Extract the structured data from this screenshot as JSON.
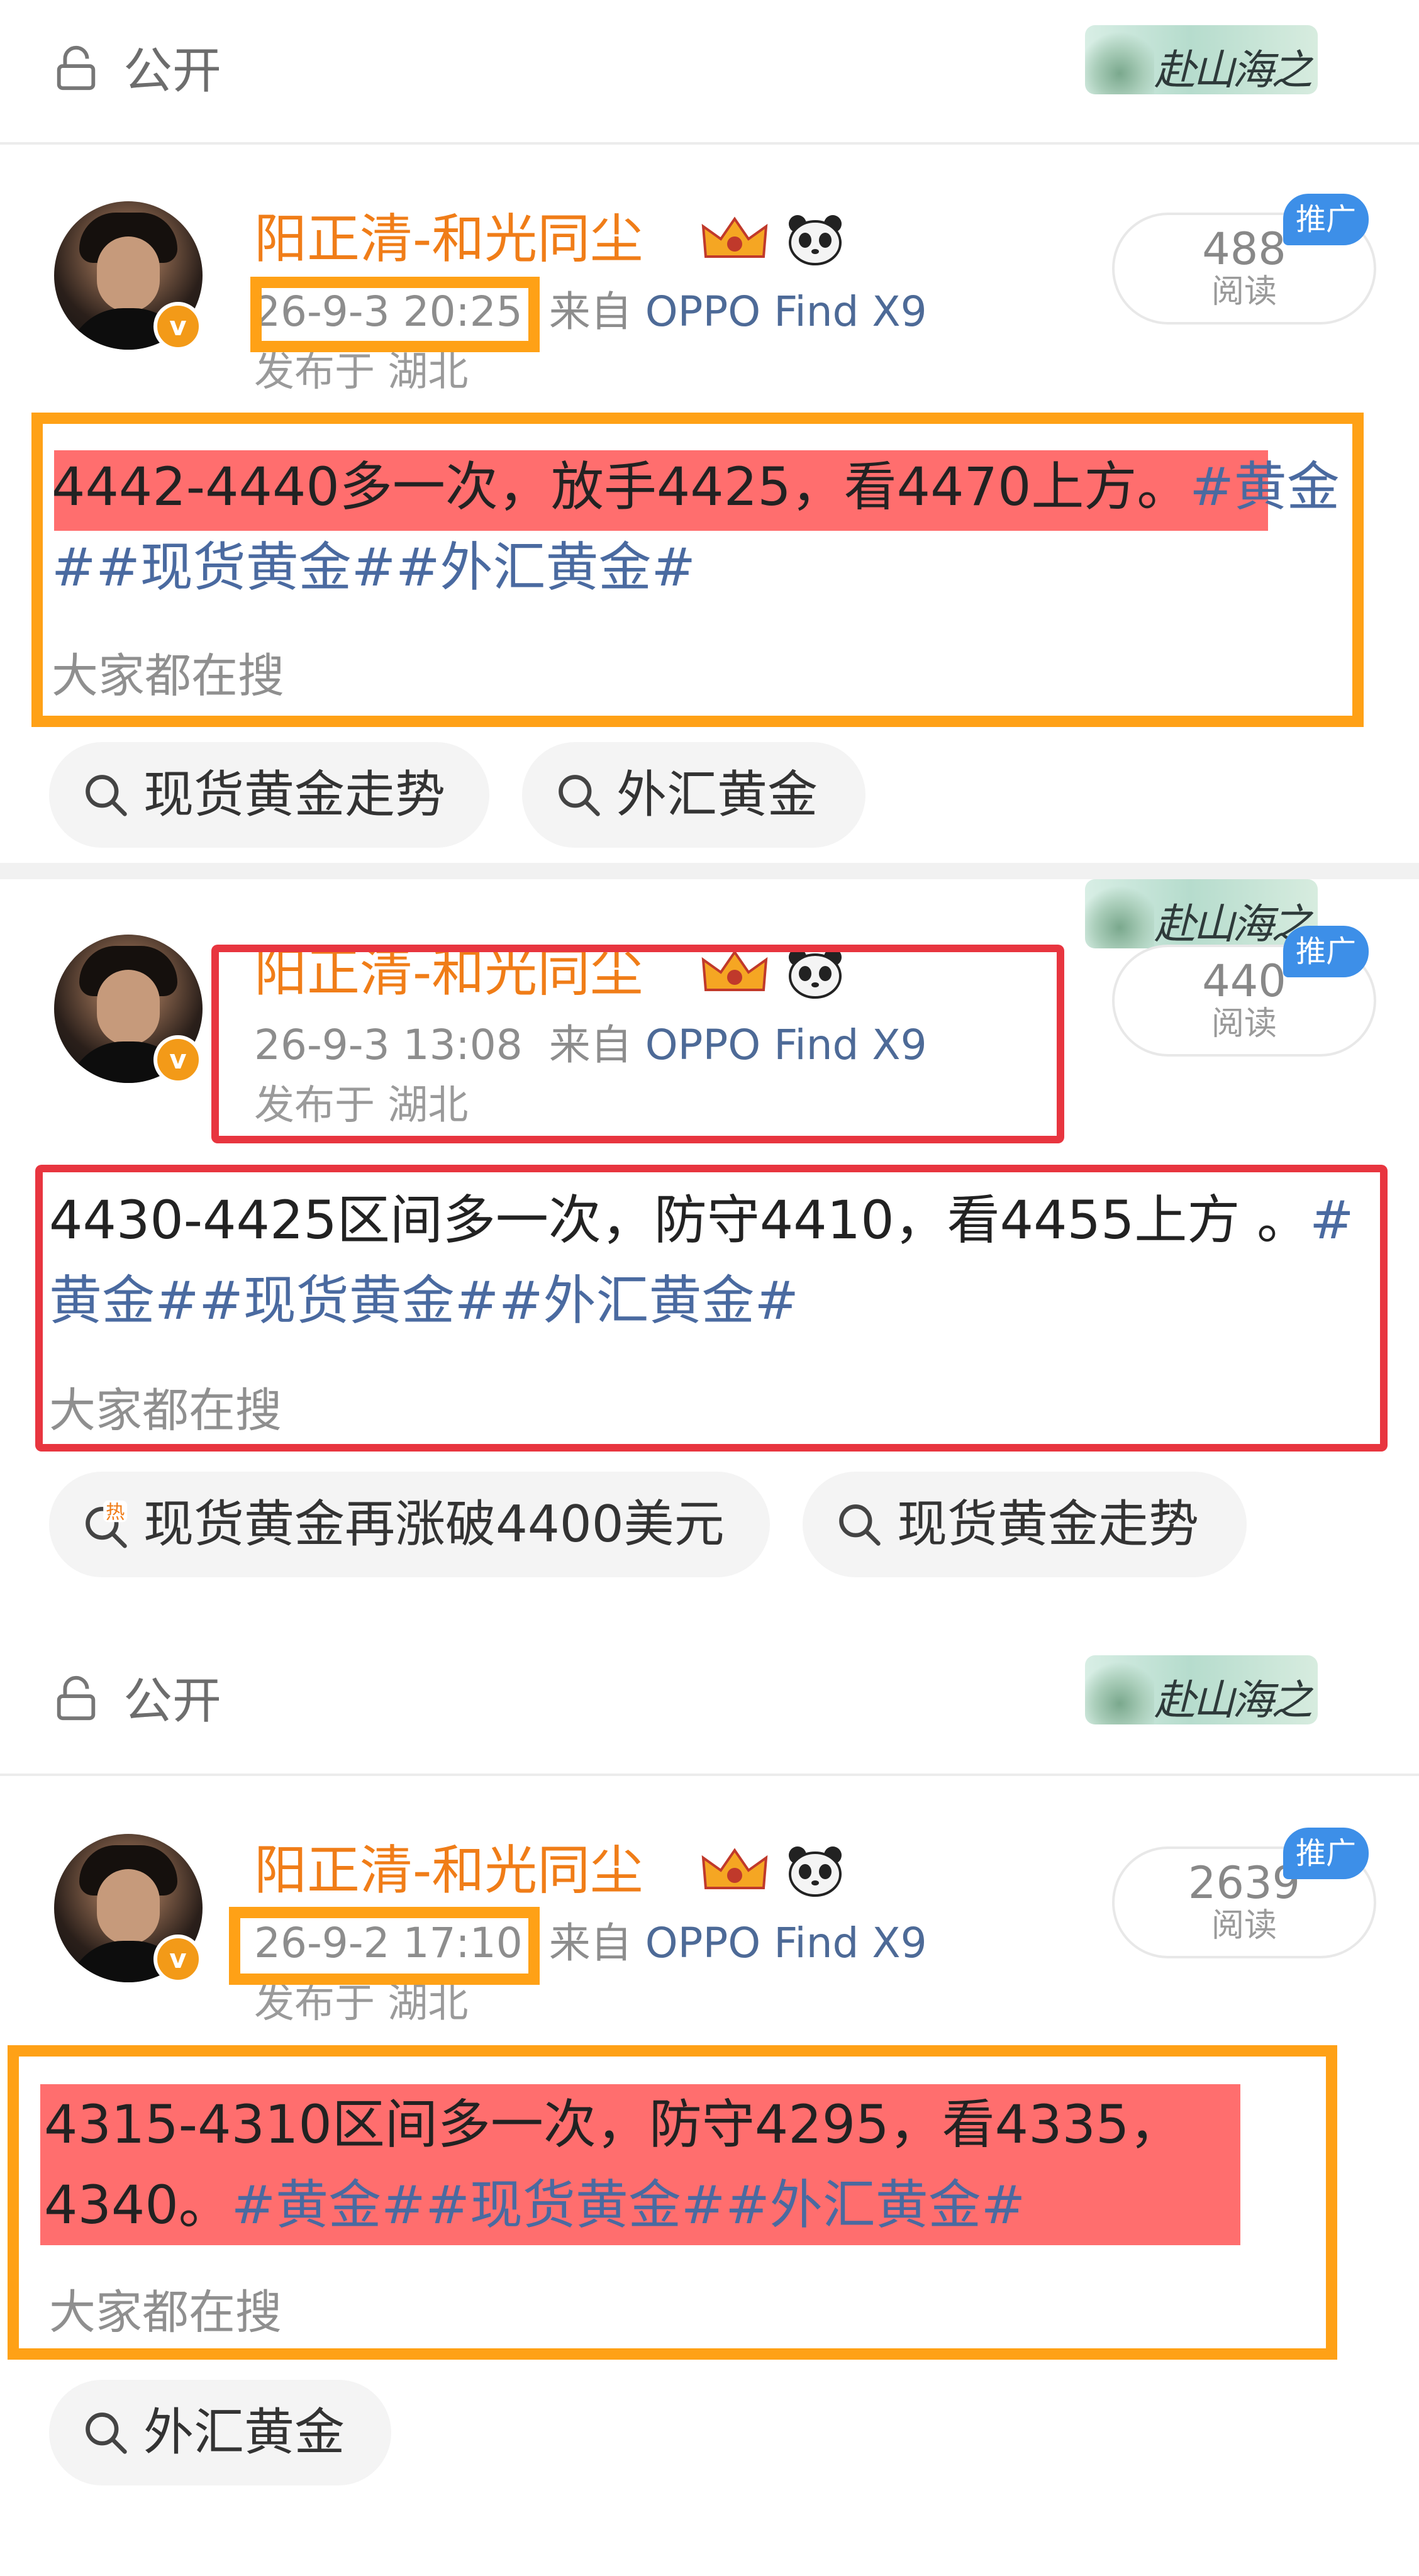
{
  "public_bar": {
    "label": "公开",
    "banner_text": "赴山海之约"
  },
  "post_common": {
    "reads_label": "阅读",
    "promo_label": "推广",
    "location": "发布于 湖北",
    "search_label": "大家都在搜"
  },
  "posts": [
    {
      "author": "阳正清-和光同尘",
      "time": "26-9-3 20:25",
      "source_prefix": "来自",
      "device": "OPPO Find X9",
      "reads": "488",
      "content_text": "4442-4440多一次，放手4425，看4470上方。",
      "content_tags": "#黄金##现货黄金##外汇黄金#",
      "chips": [
        "现货黄金走势",
        "外汇黄金"
      ]
    },
    {
      "author": "阳正清-和光同尘",
      "time": "26-9-3 13:08",
      "source_prefix": "来自",
      "device": "OPPO Find X9",
      "reads": "440",
      "content_text": "4430-4425区间多一次，防守4410，看4455上方 。",
      "content_tags": "#黄金##现货黄金##外汇黄金#",
      "chips": [
        "现货黄金再涨破4400美元",
        "现货黄金走势"
      ],
      "hot_label": "热"
    },
    {
      "author": "阳正清-和光同尘",
      "time": "26-9-2 17:10",
      "source_prefix": "来自",
      "device": "OPPO Find X9",
      "reads": "2639",
      "content_text": "4315-4310区间多一次，防守4295，看4335，4340。",
      "content_tags": "#黄金##现货黄金##外汇黄金#",
      "chips": [
        "外汇黄金"
      ]
    }
  ],
  "colors": {
    "highlight_box": "#ffa116",
    "red_box": "#e8353f",
    "name": "#f07d18",
    "tag": "#4a6aa0"
  }
}
